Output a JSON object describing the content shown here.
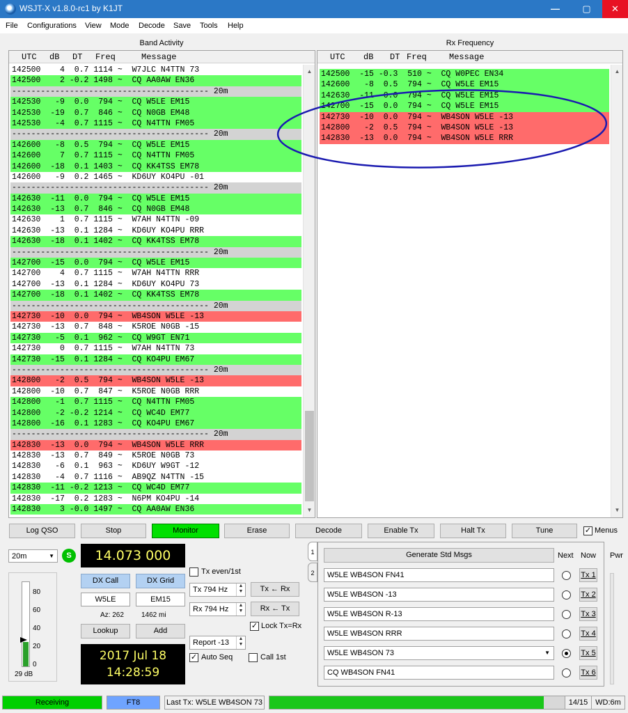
{
  "window": {
    "title": "WSJT-X   v1.8.0-rc1   by K1JT",
    "minimize": "—",
    "maximize": "▢",
    "close": "✕"
  },
  "menu": [
    "File",
    "Configurations",
    "View",
    "Mode",
    "Decode",
    "Save",
    "Tools",
    "Help"
  ],
  "band_activity": {
    "title": "Band Activity",
    "columns": [
      "UTC",
      "dB",
      "DT",
      "Freq",
      "Message"
    ],
    "rows": [
      {
        "t": "142500    4  0.7 1114 ~  W7JLC N4TTN 73",
        "k": "plain"
      },
      {
        "t": "142500    2 -0.2 1498 ~  CQ AA0AW EN36",
        "k": "cq"
      },
      {
        "t": "----------------------------------------- 20m",
        "k": "sep"
      },
      {
        "t": "142530   -9  0.0  794 ~  CQ W5LE EM15",
        "k": "cq"
      },
      {
        "t": "142530  -19  0.7  846 ~  CQ N0GB EM48",
        "k": "cq"
      },
      {
        "t": "142530   -4  0.7 1115 ~  CQ N4TTN FM05",
        "k": "cq"
      },
      {
        "t": "----------------------------------------- 20m",
        "k": "sep"
      },
      {
        "t": "142600   -8  0.5  794 ~  CQ W5LE EM15",
        "k": "cq"
      },
      {
        "t": "142600    7  0.7 1115 ~  CQ N4TTN FM05",
        "k": "cq"
      },
      {
        "t": "142600  -18  0.1 1403 ~  CQ KK4TSS EM78",
        "k": "cq"
      },
      {
        "t": "142600   -9  0.2 1465 ~  KD6UY KO4PU -01",
        "k": "plain"
      },
      {
        "t": "----------------------------------------- 20m",
        "k": "sep"
      },
      {
        "t": "142630  -11  0.0  794 ~  CQ W5LE EM15",
        "k": "cq"
      },
      {
        "t": "142630  -13  0.7  846 ~  CQ N0GB EM48",
        "k": "cq"
      },
      {
        "t": "142630    1  0.7 1115 ~  W7AH N4TTN -09",
        "k": "plain"
      },
      {
        "t": "142630  -13  0.1 1284 ~  KD6UY KO4PU RRR",
        "k": "plain"
      },
      {
        "t": "142630  -18  0.1 1402 ~  CQ KK4TSS EM78",
        "k": "cq"
      },
      {
        "t": "----------------------------------------- 20m",
        "k": "sep"
      },
      {
        "t": "142700  -15  0.0  794 ~  CQ W5LE EM15",
        "k": "cq"
      },
      {
        "t": "142700    4  0.7 1115 ~  W7AH N4TTN RRR",
        "k": "plain"
      },
      {
        "t": "142700  -13  0.1 1284 ~  KD6UY KO4PU 73",
        "k": "plain"
      },
      {
        "t": "142700  -18  0.1 1402 ~  CQ KK4TSS EM78",
        "k": "cq"
      },
      {
        "t": "----------------------------------------- 20m",
        "k": "sep"
      },
      {
        "t": "142730  -10  0.0  794 ~  WB4SON W5LE -13",
        "k": "me"
      },
      {
        "t": "142730  -13  0.7  848 ~  K5ROE N0GB -15",
        "k": "plain"
      },
      {
        "t": "142730   -5  0.1  962 ~  CQ W9GT EN71",
        "k": "cq"
      },
      {
        "t": "142730    0  0.7 1115 ~  W7AH N4TTN 73",
        "k": "plain"
      },
      {
        "t": "142730  -15  0.1 1284 ~  CQ KO4PU EM67",
        "k": "cq"
      },
      {
        "t": "----------------------------------------- 20m",
        "k": "sep"
      },
      {
        "t": "142800   -2  0.5  794 ~  WB4SON W5LE -13",
        "k": "me"
      },
      {
        "t": "142800  -10  0.7  847 ~  K5ROE N0GB RRR",
        "k": "plain"
      },
      {
        "t": "142800   -1  0.7 1115 ~  CQ N4TTN FM05",
        "k": "cq"
      },
      {
        "t": "142800   -2 -0.2 1214 ~  CQ WC4D EM77",
        "k": "cq"
      },
      {
        "t": "142800  -16  0.1 1283 ~  CQ KO4PU EM67",
        "k": "cq"
      },
      {
        "t": "----------------------------------------- 20m",
        "k": "sep"
      },
      {
        "t": "142830  -13  0.0  794 ~  WB4SON W5LE RRR",
        "k": "me"
      },
      {
        "t": "142830  -13  0.7  849 ~  K5ROE N0GB 73",
        "k": "plain"
      },
      {
        "t": "142830   -6  0.1  963 ~  KD6UY W9GT -12",
        "k": "plain"
      },
      {
        "t": "142830   -4  0.7 1116 ~  AB9QZ N4TTN -15",
        "k": "plain"
      },
      {
        "t": "142830  -11 -0.2 1213 ~  CQ WC4D EM77",
        "k": "cq"
      },
      {
        "t": "142830  -17  0.2 1283 ~  N6PM KO4PU -14",
        "k": "plain"
      },
      {
        "t": "142830    3 -0.0 1497 ~  CQ AA0AW EN36",
        "k": "cq"
      }
    ]
  },
  "rx_frequency": {
    "title": "Rx Frequency",
    "columns": [
      "UTC",
      "dB",
      "DT",
      "Freq",
      "Message"
    ],
    "rows": [
      {
        "t": "142500  -15 -0.3  510 ~  CQ W0PEC EN34",
        "k": "cq"
      },
      {
        "t": "142600   -8  0.5  794 ~  CQ W5LE EM15",
        "k": "cq"
      },
      {
        "t": "142630  -11  0.0  794 ~  CQ W5LE EM15",
        "k": "cq"
      },
      {
        "t": "142700  -15  0.0  794 ~  CQ W5LE EM15",
        "k": "cq"
      },
      {
        "t": "142730  -10  0.0  794 ~  WB4SON W5LE -13",
        "k": "me"
      },
      {
        "t": "142800   -2  0.5  794 ~  WB4SON W5LE -13",
        "k": "me"
      },
      {
        "t": "142830  -13  0.0  794 ~  WB4SON W5LE RRR",
        "k": "me"
      }
    ]
  },
  "buttons": {
    "log_qso": "Log QSO",
    "stop": "Stop",
    "monitor": "Monitor",
    "erase": "Erase",
    "decode": "Decode",
    "enable_tx": "Enable Tx",
    "halt_tx": "Halt Tx",
    "tune": "Tune",
    "menus": "Menus"
  },
  "band": "20m",
  "s_indicator": "S",
  "dial_freq": "14.073 000",
  "dx": {
    "call_label": "DX Call",
    "grid_label": "DX Grid",
    "call": "W5LE",
    "grid": "EM15",
    "az": "Az: 262",
    "dist": "1462 mi",
    "lookup": "Lookup",
    "add": "Add"
  },
  "meter": {
    "ticks": [
      "80",
      "60",
      "40",
      "20",
      "0"
    ],
    "level_db": "29 dB",
    "level_fraction": 0.29
  },
  "datetime": {
    "date": "2017 Jul 18",
    "time": "14:28:59"
  },
  "controls": {
    "tx_even": "Tx even/1st",
    "tx_hz": "Tx  794  Hz",
    "rx_hz": "Rx  794  Hz",
    "tx_from_rx": "Tx ← Rx",
    "rx_from_tx": "Rx ← Tx",
    "lock": "Lock Tx=Rx",
    "report": "Report -13",
    "auto_seq": "Auto Seq",
    "call_1st": "Call 1st"
  },
  "tx_panel": {
    "tabs": [
      "1",
      "2"
    ],
    "generate": "Generate Std Msgs",
    "next": "Next",
    "now": "Now",
    "pwr": "Pwr",
    "msgs": [
      {
        "text": "W5LE WB4SON FN41",
        "btn": "Tx 1"
      },
      {
        "text": "W5LE WB4SON -13",
        "btn": "Tx 2"
      },
      {
        "text": "W5LE WB4SON R-13",
        "btn": "Tx 3"
      },
      {
        "text": "W5LE WB4SON RRR",
        "btn": "Tx 4"
      },
      {
        "text": "W5LE WB4SON 73",
        "btn": "Tx 5"
      },
      {
        "text": "CQ WB4SON FN41",
        "btn": "Tx 6"
      }
    ],
    "selected_next": 4
  },
  "status": {
    "receiving": "Receiving",
    "mode": "FT8",
    "last_tx": "Last Tx: W5LE WB4SON 73",
    "progress_fraction": 0.93,
    "seq": "14/15",
    "wd": "WD:6m"
  },
  "colors": {
    "cq": "#66ff66",
    "me": "#ff6b6b",
    "sep": "#d3d3d3",
    "annotation": "#1a1ab0"
  }
}
